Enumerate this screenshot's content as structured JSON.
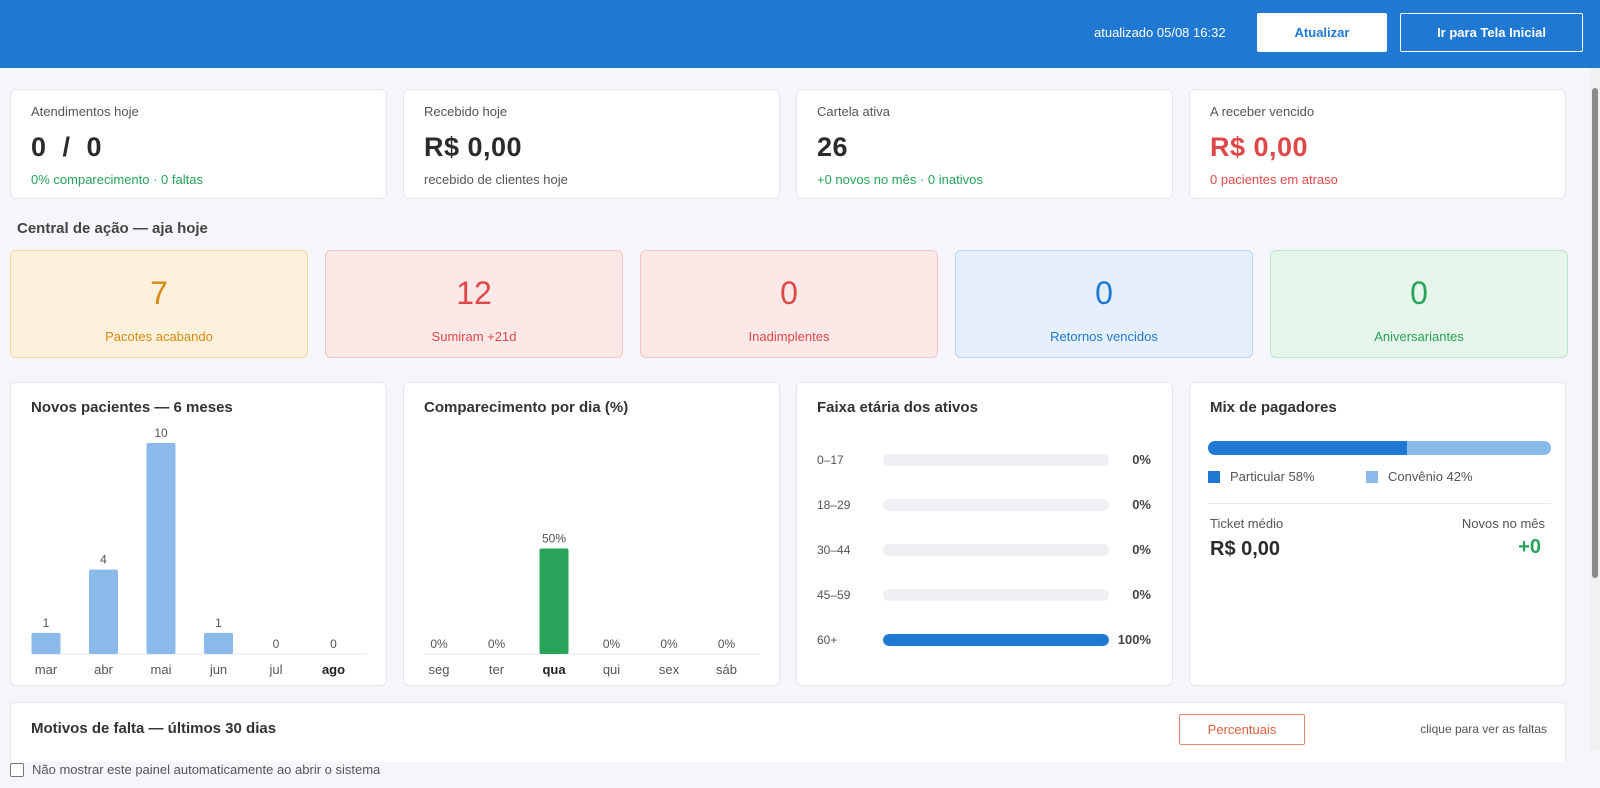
{
  "header": {
    "updated": "atualizado 05/08 16:32",
    "refresh_label": "Atualizar",
    "home_label": "Ir para Tela Inicial"
  },
  "kpis": [
    {
      "label": "Atendimentos hoje",
      "value": "0  /  0",
      "sub": "0% comparecimento · 0 faltas",
      "sub_color": "#27a35a",
      "value_color": "#2b2b2b"
    },
    {
      "label": "Recebido hoje",
      "value": "R$ 0,00",
      "sub": "recebido de clientes hoje",
      "sub_color": "#555555",
      "value_color": "#2b2b2b"
    },
    {
      "label": "Cartela ativa",
      "value": "26",
      "sub": "+0 novos no mês · 0 inativos",
      "sub_color": "#27a35a",
      "value_color": "#2b2b2b"
    },
    {
      "label": "A receber vencido",
      "value": "R$ 0,00",
      "sub": "0 pacientes em atraso",
      "sub_color": "#e04848",
      "value_color": "#e04848"
    }
  ],
  "action_center": {
    "title": "Central de ação — aja hoje",
    "items": [
      {
        "value": "7",
        "label": "Pacotes acabando",
        "color": "#d98a14",
        "bg": "#fdf1dc",
        "border": "#f3d9a6"
      },
      {
        "value": "12",
        "label": "Sumiram +21d",
        "color": "#e04848",
        "bg": "#fde8e8",
        "border": "#f5c4c4"
      },
      {
        "value": "0",
        "label": "Inadimplentes",
        "color": "#e04848",
        "bg": "#fde8e8",
        "border": "#f5c4c4"
      },
      {
        "value": "0",
        "label": "Retornos vencidos",
        "color": "#1f78d1",
        "bg": "#e6f0fc",
        "border": "#bcd5f3"
      },
      {
        "value": "0",
        "label": "Aniversariantes",
        "color": "#27a35a",
        "bg": "#e6f5ea",
        "border": "#bfe3c9"
      }
    ]
  },
  "new_patients": {
    "title": "Novos pacientes — 6 meses",
    "chart_data": {
      "type": "bar",
      "categories": [
        "mar",
        "abr",
        "mai",
        "jun",
        "jul",
        "ago"
      ],
      "values": [
        1,
        4,
        10,
        1,
        0,
        0
      ],
      "value_labels": [
        "1",
        "4",
        "10",
        "1",
        "0",
        "0"
      ],
      "ylim": [
        0,
        10
      ],
      "bar_color": "#8ab9ea",
      "highlight_category": "ago"
    }
  },
  "attendance": {
    "title": "Comparecimento por dia (%)",
    "chart_data": {
      "type": "bar",
      "categories": [
        "seg",
        "ter",
        "qua",
        "qui",
        "sex",
        "sáb"
      ],
      "values": [
        0,
        0,
        50,
        0,
        0,
        0
      ],
      "value_labels": [
        "0%",
        "0%",
        "50%",
        "0%",
        "0%",
        "0%"
      ],
      "ylim": [
        0,
        100
      ],
      "bar_color": "#27a35a",
      "highlight_category": "qua"
    }
  },
  "age_range": {
    "title": "Faixa etária dos ativos",
    "chart_data": {
      "type": "bar",
      "categories": [
        "0–17",
        "18–29",
        "30–44",
        "45–59",
        "60+"
      ],
      "values": [
        0,
        0,
        0,
        0,
        100
      ],
      "value_labels": [
        "0%",
        "0%",
        "0%",
        "0%",
        "100%"
      ],
      "ylim": [
        0,
        100
      ]
    }
  },
  "payers": {
    "title": "Mix de pagadores",
    "particular_pct": 58,
    "convenio_pct": 42,
    "particular_label": "Particular 58%",
    "convenio_label": "Convênio 42%",
    "particular_color": "#1f78d1",
    "convenio_color": "#8ab9ea",
    "ticket_label": "Ticket médio",
    "ticket_value": "R$ 0,00",
    "new_label": "Novos no mês",
    "new_value": "+0"
  },
  "absence": {
    "title": "Motivos de falta — últimos 30 dias",
    "percent_button": "Percentuais",
    "hint": "clique para ver as faltas"
  },
  "footer": {
    "dont_show": "Não mostrar este painel automaticamente ao abrir o sistema"
  }
}
